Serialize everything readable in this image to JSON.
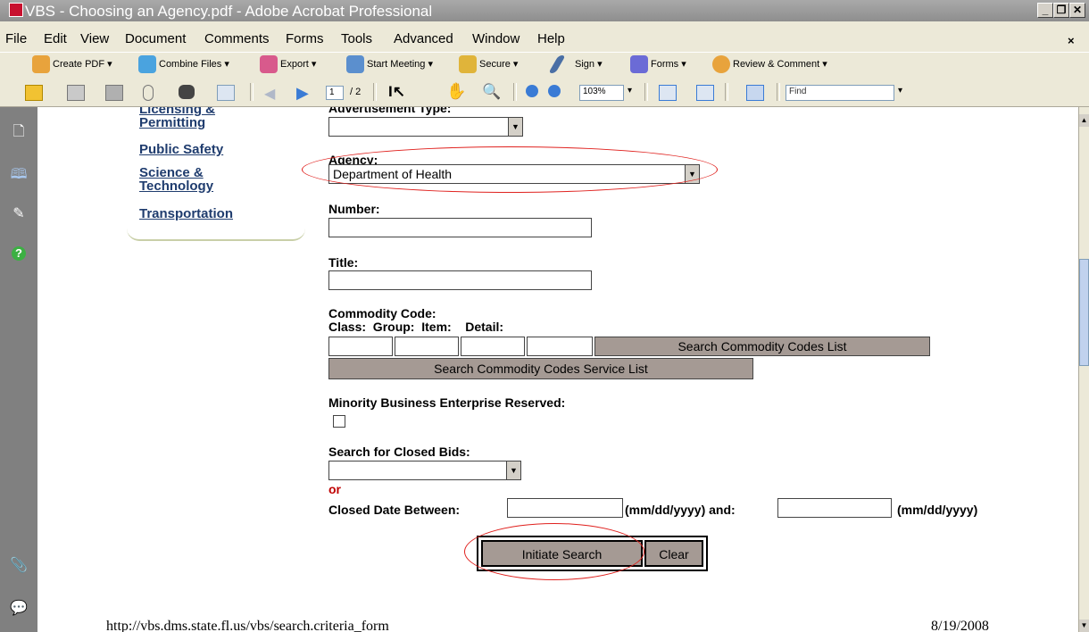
{
  "window": {
    "title": "VBS - Choosing an Agency.pdf - Adobe Acrobat Professional",
    "minimize": "_",
    "restore": "❐",
    "close": "✕",
    "doc_close": "×"
  },
  "menu": [
    "File",
    "Edit",
    "View",
    "Document",
    "Comments",
    "Forms",
    "Tools",
    "Advanced",
    "Window",
    "Help"
  ],
  "toolbar1": {
    "create_pdf": "Create PDF ▾",
    "combine_files": "Combine Files ▾",
    "export": "Export ▾",
    "start_meeting": "Start Meeting ▾",
    "secure": "Secure ▾",
    "sign": "Sign ▾",
    "forms": "Forms ▾",
    "review_comment": "Review & Comment ▾"
  },
  "toolbar2": {
    "page_current": "1",
    "page_total": "/ 2",
    "zoom": "103%",
    "find_placeholder": "Find"
  },
  "nav": {
    "links": [
      "Licensing & Permitting",
      "Public Safety",
      "Science & Technology",
      "Transportation"
    ]
  },
  "form": {
    "advert_label": "Advertisement Type:",
    "advert_value": "",
    "agency_label": "Agency:",
    "agency_value": "Department of Health",
    "number_label": "Number:",
    "title_label": "Title:",
    "commodity_label": "Commodity Code:",
    "commodity_sub": "Class:  Group:  Item:    Detail:",
    "search_codes_btn": "Search Commodity Codes List",
    "search_service_btn": "Search Commodity Codes Service List",
    "mbe_label": "Minority Business Enterprise Reserved:",
    "closed_bids_label": "Search for Closed Bids:",
    "or_text": "or",
    "closed_date_label": "Closed Date Between:",
    "date_fmt1": "(mm/dd/yyyy) and:",
    "date_fmt2": "(mm/dd/yyyy)",
    "initiate_btn": "Initiate Search",
    "clear_btn": "Clear"
  },
  "footer": {
    "url": "http://vbs.dms.state.fl.us/vbs/search.criteria_form",
    "date": "8/19/2008"
  },
  "colors": {
    "highlight_circle": "#e0221f",
    "link": "#1f3c6e",
    "button": "#a59a94",
    "or_text": "#c00000"
  }
}
